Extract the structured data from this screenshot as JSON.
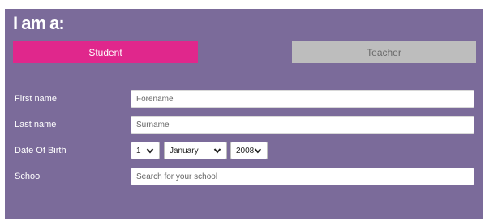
{
  "form": {
    "title": "I am a:",
    "roles": {
      "student": "Student",
      "teacher": "Teacher",
      "selected": "student"
    },
    "fields": {
      "first_name": {
        "label": "First name",
        "placeholder": "Forename"
      },
      "last_name": {
        "label": "Last name",
        "placeholder": "Surname"
      },
      "dob": {
        "label": "Date Of Birth",
        "day": "1",
        "month": "January",
        "year": "2008"
      },
      "school": {
        "label": "School",
        "placeholder": "Search for your school"
      }
    }
  },
  "colors": {
    "panel": "#7b6b9a",
    "student_active": "#e0278c",
    "teacher_inactive": "#bdbdbd"
  },
  "icons": [
    "chevron-down-icon"
  ]
}
